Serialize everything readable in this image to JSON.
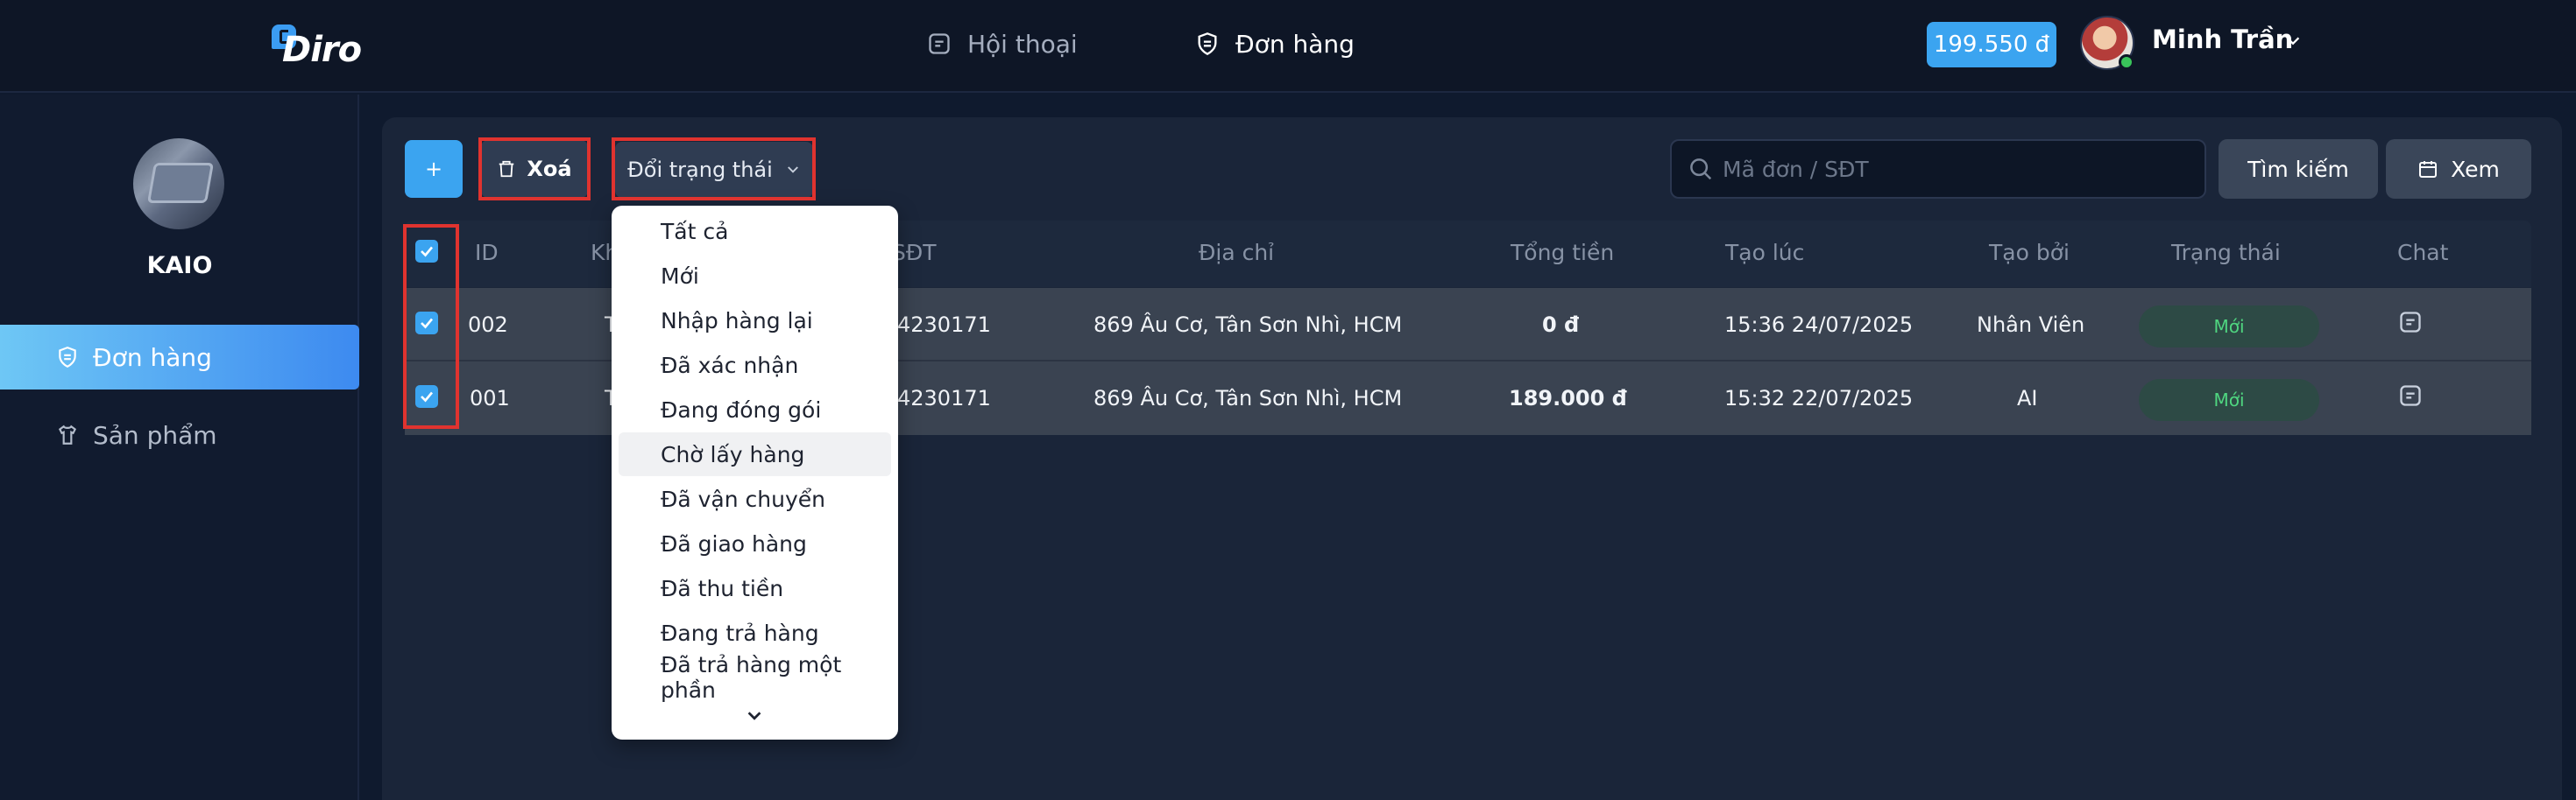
{
  "header": {
    "logo_text": "Diro",
    "nav": [
      {
        "label": "Hội thoại",
        "icon": "message-square-icon"
      },
      {
        "label": "Đơn hàng",
        "icon": "shield-icon"
      }
    ],
    "balance": "199.550 đ",
    "user_name": "Minh Trần"
  },
  "sidebar": {
    "shop_name": "KAIO",
    "items": [
      {
        "label": "Đơn hàng",
        "icon": "shield-icon",
        "active": true
      },
      {
        "label": "Sản phẩm",
        "icon": "shirt-icon",
        "active": false
      }
    ]
  },
  "toolbar": {
    "add_label": "+",
    "delete_label": "Xoá",
    "status_label": "Đổi trạng thái",
    "search_placeholder": "Mã đơn / SĐT",
    "search_button": "Tìm kiếm",
    "view_button": "Xem"
  },
  "table": {
    "headers": [
      "ID",
      "Kh",
      "SĐT",
      "Địa chỉ",
      "Tổng tiền",
      "Tạo lúc",
      "Tạo bởi",
      "Trạng thái",
      "Chat"
    ],
    "rows": [
      {
        "id": "002",
        "customer": "T",
        "phone": "4230171",
        "address": "869 Âu Cơ, Tân Sơn Nhì, HCM",
        "total": "0 đ",
        "created_at": "15:36 24/07/2025",
        "created_by": "Nhân Viên",
        "status": "Mới"
      },
      {
        "id": "001",
        "customer": "T",
        "phone": "4230171",
        "address": "869 Âu Cơ, Tân Sơn Nhì, HCM",
        "total": "189.000 đ",
        "created_at": "15:32 22/07/2025",
        "created_by": "AI",
        "status": "Mới"
      }
    ]
  },
  "status_dropdown": {
    "options": [
      "Tất cả",
      "Mới",
      "Nhập hàng lại",
      "Đã xác nhận",
      "Đang đóng gói",
      "Chờ lấy hàng",
      "Đã vận chuyển",
      "Đã giao hàng",
      "Đã thu tiền",
      "Đang trả hàng",
      "Đã trả hàng một phần"
    ],
    "hovered": "Chờ lấy hàng"
  },
  "colors": {
    "accent": "#3ba4f0",
    "highlight_frame": "#e0332f",
    "status_new": "#4fd680"
  }
}
